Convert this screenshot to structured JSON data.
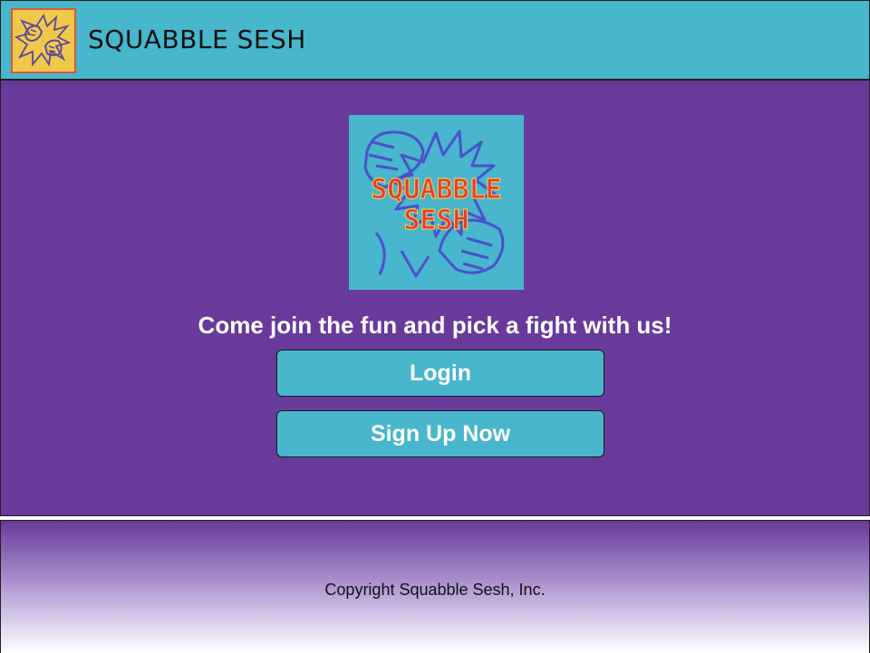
{
  "header": {
    "title": "SQUABBLE SESH",
    "logo_icon": "fist-bump-icon"
  },
  "main": {
    "logo_text_line1": "SQUABBLE",
    "logo_text_line2": "SESH",
    "tagline": "Come join the fun and pick a fight with us!",
    "login_label": "Login",
    "signup_label": "Sign Up Now"
  },
  "footer": {
    "copyright": "Copyright Squabble Sesh, Inc."
  },
  "colors": {
    "header_bg": "#48b6cc",
    "main_bg": "#683a99",
    "button_bg": "#48b6cc",
    "logo_text": "#e23b3b"
  }
}
